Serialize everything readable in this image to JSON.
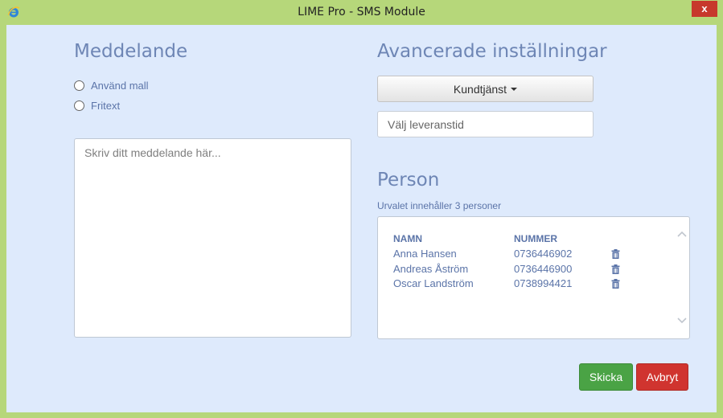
{
  "window": {
    "title": "LIME Pro - SMS Module",
    "close_label": "x",
    "app_icon": "ie-logo-icon"
  },
  "message": {
    "heading": "Meddelande",
    "options": [
      "Använd mall",
      "Fritext"
    ],
    "placeholder": "Skriv ditt meddelande här..."
  },
  "advanced": {
    "heading": "Avancerade inställningar",
    "sender_dropdown": "Kundtjänst",
    "delivery_time_placeholder": "Välj leveranstid"
  },
  "person": {
    "heading": "Person",
    "selection_info": "Urvalet innehåller 3 personer",
    "columns": [
      "NAMN",
      "NUMMER"
    ],
    "rows": [
      {
        "name": "Anna Hansen",
        "number": "0736446902"
      },
      {
        "name": "Andreas Åström",
        "number": "0736446900"
      },
      {
        "name": "Oscar Landström",
        "number": "0738994421"
      }
    ]
  },
  "actions": {
    "send": "Skicka",
    "cancel": "Avbryt"
  },
  "colors": {
    "frame": "#b6d77a",
    "client_bg": "#deeafc",
    "heading": "#6e86b5",
    "text_blue": "#5b74a8",
    "send": "#4aa345",
    "cancel": "#d0342f",
    "close": "#c7382c"
  }
}
